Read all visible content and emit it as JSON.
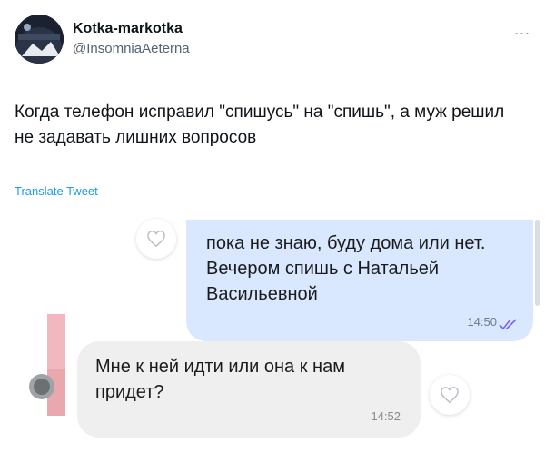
{
  "tweet": {
    "display_name": "Kotka-markotka",
    "handle": "@InsomniaAeterna",
    "more_label": "...",
    "text": "Когда телефон исправил \"спишусь\" на \"спишь\", а муж решил не задавать лишних вопросов",
    "translate_label": "Translate Tweet"
  },
  "chat": {
    "outgoing": {
      "text": "пока не знаю, буду дома или нет. Вечером спишь с Натальей Васильевной",
      "time": "14:50",
      "status_icon": "double-check-icon"
    },
    "incoming": {
      "text": "Мне к ней идти или она к нам придет?",
      "time": "14:52"
    }
  },
  "colors": {
    "link": "#1d9bf0",
    "outgoing_bubble": "#d9e8ff",
    "incoming_bubble": "#efefef",
    "check": "#7b61ff"
  }
}
